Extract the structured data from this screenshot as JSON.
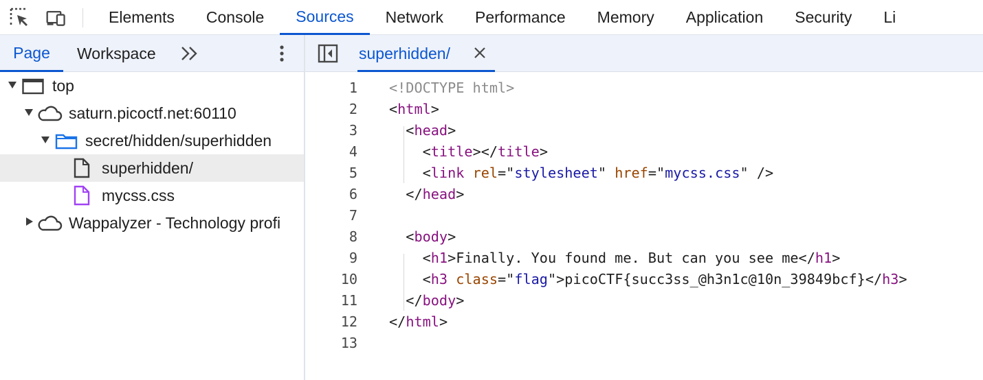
{
  "toolbar": {
    "inspect_icon": "inspect-element-icon",
    "device_icon": "device-toolbar-icon",
    "tabs": [
      {
        "label": "Elements"
      },
      {
        "label": "Console"
      },
      {
        "label": "Sources"
      },
      {
        "label": "Network"
      },
      {
        "label": "Performance"
      },
      {
        "label": "Memory"
      },
      {
        "label": "Application"
      },
      {
        "label": "Security"
      },
      {
        "label": "Li"
      }
    ],
    "active_tab": "Sources"
  },
  "navigator": {
    "tabs": [
      {
        "label": "Page"
      },
      {
        "label": "Workspace"
      }
    ],
    "more_label": ">>",
    "tree": [
      {
        "label": "top"
      },
      {
        "label": "saturn.picoctf.net:60110"
      },
      {
        "label": "secret/hidden/superhidden"
      },
      {
        "label": "superhidden/"
      },
      {
        "label": "mycss.css"
      },
      {
        "label": "Wappalyzer - Technology profi"
      }
    ]
  },
  "editor": {
    "open_file": "superhidden/",
    "close_glyph": "✕",
    "lines": [
      [
        {
          "t": "doctype",
          "v": "<!DOCTYPE html>"
        }
      ],
      [
        {
          "t": "br",
          "v": "<"
        },
        {
          "t": "tag",
          "v": "html"
        },
        {
          "t": "br",
          "v": ">"
        }
      ],
      [
        {
          "t": "br",
          "v": "  <"
        },
        {
          "t": "tag",
          "v": "head"
        },
        {
          "t": "br",
          "v": ">"
        }
      ],
      [
        {
          "t": "br",
          "v": "    <"
        },
        {
          "t": "tag",
          "v": "title"
        },
        {
          "t": "br",
          "v": "></"
        },
        {
          "t": "tag",
          "v": "title"
        },
        {
          "t": "br",
          "v": ">"
        }
      ],
      [
        {
          "t": "br",
          "v": "    <"
        },
        {
          "t": "tag",
          "v": "link"
        },
        {
          "t": "br",
          "v": " "
        },
        {
          "t": "attr",
          "v": "rel"
        },
        {
          "t": "br",
          "v": "=\""
        },
        {
          "t": "val",
          "v": "stylesheet"
        },
        {
          "t": "br",
          "v": "\" "
        },
        {
          "t": "attr",
          "v": "href"
        },
        {
          "t": "br",
          "v": "=\""
        },
        {
          "t": "val",
          "v": "mycss.css"
        },
        {
          "t": "br",
          "v": "\" />"
        }
      ],
      [
        {
          "t": "br",
          "v": "  </"
        },
        {
          "t": "tag",
          "v": "head"
        },
        {
          "t": "br",
          "v": ">"
        }
      ],
      [],
      [
        {
          "t": "br",
          "v": "  <"
        },
        {
          "t": "tag",
          "v": "body"
        },
        {
          "t": "br",
          "v": ">"
        }
      ],
      [
        {
          "t": "br",
          "v": "    <"
        },
        {
          "t": "tag",
          "v": "h1"
        },
        {
          "t": "br",
          "v": ">Finally. You found me. But can you see me</"
        },
        {
          "t": "tag",
          "v": "h1"
        },
        {
          "t": "br",
          "v": ">"
        }
      ],
      [
        {
          "t": "br",
          "v": "    <"
        },
        {
          "t": "tag",
          "v": "h3"
        },
        {
          "t": "br",
          "v": " "
        },
        {
          "t": "attr",
          "v": "class"
        },
        {
          "t": "br",
          "v": "=\""
        },
        {
          "t": "val",
          "v": "flag"
        },
        {
          "t": "br",
          "v": "\">picoCTF{succ3ss_@h3n1c@10n_39849bcf}</"
        },
        {
          "t": "tag",
          "v": "h3"
        },
        {
          "t": "br",
          "v": ">"
        }
      ],
      [
        {
          "t": "br",
          "v": "  </"
        },
        {
          "t": "tag",
          "v": "body"
        },
        {
          "t": "br",
          "v": ">"
        }
      ],
      [
        {
          "t": "br",
          "v": "</"
        },
        {
          "t": "tag",
          "v": "html"
        },
        {
          "t": "br",
          "v": ">"
        }
      ],
      []
    ]
  }
}
